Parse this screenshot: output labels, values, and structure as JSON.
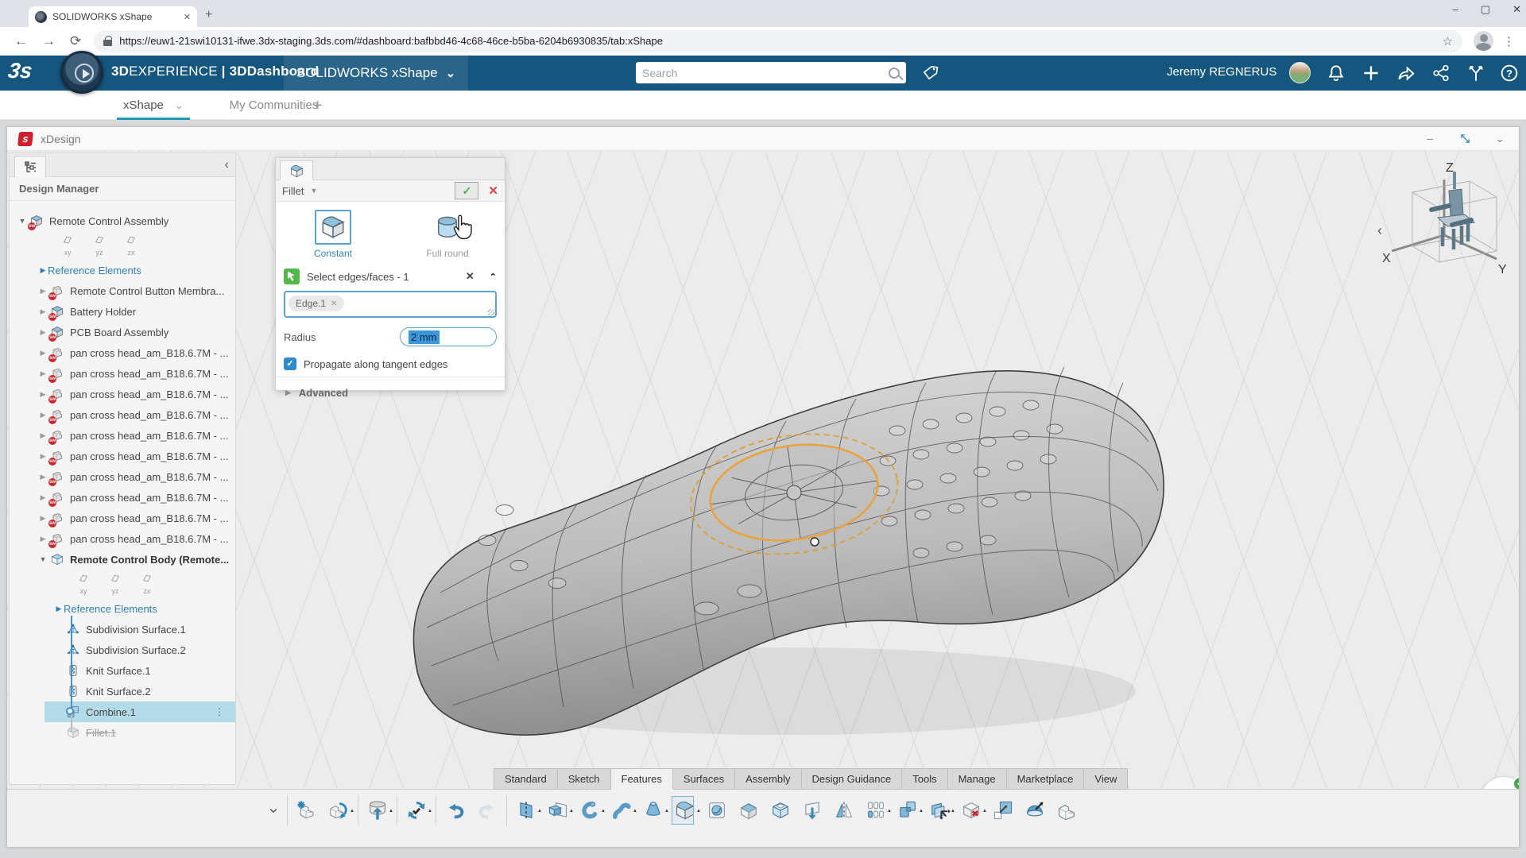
{
  "browser": {
    "tab_title": "SOLIDWORKS xShape",
    "url": "https://euw1-21swi10131-ifwe.3dx-staging.3ds.com/#dashboard:bafbbd46-4c68-46ce-b5ba-6204b6930835/tab:xShape"
  },
  "top_bar": {
    "brand_bold": "3D",
    "brand_light": "EXPERIENCE",
    "divider": "|",
    "dashboard_name": "3DDashboard",
    "app_name": "SOLIDWORKS xShape",
    "search_placeholder": "Search",
    "user_name": "Jeremy REGNERUS",
    "logo_text": "3s"
  },
  "dashboard_tabs": {
    "items": [
      {
        "label": "xShape",
        "active": true,
        "chevron": true
      },
      {
        "label": "My Communities",
        "active": false
      }
    ]
  },
  "app_window": {
    "title": "xDesign",
    "logo_text": "s"
  },
  "design_manager": {
    "title": "Design Manager",
    "tree": [
      {
        "type": "root",
        "level": 0,
        "icon": "asm",
        "badge": true,
        "label": "Remote Control Assembly",
        "expanded": true
      },
      {
        "type": "planes",
        "level": 1,
        "labels": [
          "xy",
          "yz",
          "zx"
        ]
      },
      {
        "type": "ref",
        "level": 1,
        "label": "Reference Elements"
      },
      {
        "type": "item",
        "level": 1,
        "icon": "part",
        "badge": true,
        "arrow": true,
        "label": "Remote Control Button Membra..."
      },
      {
        "type": "item",
        "level": 1,
        "icon": "asm",
        "badge": true,
        "arrow": true,
        "label": "Battery Holder"
      },
      {
        "type": "item",
        "level": 1,
        "icon": "asm",
        "badge": true,
        "arrow": true,
        "label": "PCB Board Assembly"
      },
      {
        "type": "item",
        "level": 1,
        "icon": "part",
        "badge": true,
        "arrow": true,
        "label": "pan cross head_am_B18.6.7M - ..."
      },
      {
        "type": "item",
        "level": 1,
        "icon": "part",
        "badge": true,
        "arrow": true,
        "label": "pan cross head_am_B18.6.7M - ..."
      },
      {
        "type": "item",
        "level": 1,
        "icon": "part",
        "badge": true,
        "arrow": true,
        "label": "pan cross head_am_B18.6.7M - ..."
      },
      {
        "type": "item",
        "level": 1,
        "icon": "part",
        "badge": true,
        "arrow": true,
        "label": "pan cross head_am_B18.6.7M - ..."
      },
      {
        "type": "item",
        "level": 1,
        "icon": "part",
        "badge": true,
        "arrow": true,
        "label": "pan cross head_am_B18.6.7M - ..."
      },
      {
        "type": "item",
        "level": 1,
        "icon": "part",
        "badge": true,
        "arrow": true,
        "label": "pan cross head_am_B18.6.7M - ..."
      },
      {
        "type": "item",
        "level": 1,
        "icon": "part",
        "badge": true,
        "arrow": true,
        "label": "pan cross head_am_B18.6.7M - ..."
      },
      {
        "type": "item",
        "level": 1,
        "icon": "part",
        "badge": true,
        "arrow": true,
        "label": "pan cross head_am_B18.6.7M - ..."
      },
      {
        "type": "item",
        "level": 1,
        "icon": "part",
        "badge": true,
        "arrow": true,
        "label": "pan cross head_am_B18.6.7M - ..."
      },
      {
        "type": "item",
        "level": 1,
        "icon": "part",
        "badge": true,
        "arrow": true,
        "label": "pan cross head_am_B18.6.7M - ..."
      },
      {
        "type": "root",
        "level": 1,
        "icon": "body",
        "bold": true,
        "label": "Remote Control Body (Remote...",
        "expanded": true
      },
      {
        "type": "planes",
        "level": 2,
        "labels": [
          "xy",
          "yz",
          "zx"
        ]
      },
      {
        "type": "ref",
        "level": 2,
        "label": "Reference Elements"
      },
      {
        "type": "item",
        "level": 2,
        "icon": "subdiv",
        "label": "Subdivision Surface.1",
        "tl": true
      },
      {
        "type": "item",
        "level": 2,
        "icon": "subdiv",
        "label": "Subdivision Surface.2",
        "tl": true
      },
      {
        "type": "item",
        "level": 2,
        "icon": "knit",
        "label": "Knit Surface.1",
        "tl": true
      },
      {
        "type": "item",
        "level": 2,
        "icon": "knit",
        "label": "Knit Surface.2",
        "tl": true
      },
      {
        "type": "item",
        "level": 2,
        "icon": "combine",
        "label": "Combine.1",
        "selected": true,
        "tl": "node",
        "menu": true
      },
      {
        "type": "item",
        "level": 2,
        "icon": "filletg",
        "label": "Fillet.1",
        "suppressed": true,
        "tl": "end"
      }
    ]
  },
  "fillet_panel": {
    "title": "Fillet",
    "options": [
      {
        "label": "Constant",
        "selected": true,
        "icon": "fillet"
      },
      {
        "label": "Full round",
        "selected": false,
        "icon": "cyl"
      }
    ],
    "selection_label": "Select edges/faces - 1",
    "chips": [
      "Edge.1"
    ],
    "radius_label": "Radius",
    "radius_value": "2 mm",
    "propagate_label": "Propagate along tangent edges",
    "propagate_checked": true,
    "advanced_label": "Advanced"
  },
  "viewport": {
    "axes": {
      "up": "Z",
      "left": "X",
      "right": "Y"
    }
  },
  "action_bar": {
    "tabs": [
      {
        "label": "Standard"
      },
      {
        "label": "Sketch"
      },
      {
        "label": "Features",
        "active": true
      },
      {
        "label": "Surfaces"
      },
      {
        "label": "Assembly"
      },
      {
        "label": "Design Guidance"
      },
      {
        "label": "Tools"
      },
      {
        "label": "Manage"
      },
      {
        "label": "Marketplace"
      },
      {
        "label": "View"
      }
    ],
    "tools": [
      {
        "name": "collapse-toolbar",
        "sym": "chev",
        "small": true
      },
      {
        "sep": true
      },
      {
        "name": "new-part",
        "sym": "newpart"
      },
      {
        "name": "open",
        "sym": "open",
        "dd": true
      },
      {
        "sep": true
      },
      {
        "name": "save",
        "sym": "db",
        "dd": true
      },
      {
        "sep": true
      },
      {
        "name": "update",
        "sym": "sync",
        "dd": true
      },
      {
        "sep": true
      },
      {
        "name": "undo",
        "sym": "undo"
      },
      {
        "name": "redo",
        "sym": "redo",
        "disabled": true
      },
      {
        "sep": true
      },
      {
        "name": "sketch-plane",
        "sym": "plane",
        "dd": true
      },
      {
        "name": "extrude",
        "sym": "extrude",
        "dd": true
      },
      {
        "name": "revolve",
        "sym": "revolve",
        "dd": true
      },
      {
        "name": "sweep",
        "sym": "sweep",
        "dd": true
      },
      {
        "name": "loft",
        "sym": "loft",
        "dd": true
      },
      {
        "name": "fillet",
        "sym": "fillet",
        "dd": true,
        "active": true
      },
      {
        "name": "hole",
        "sym": "hole"
      },
      {
        "name": "chamfer",
        "sym": "chamfer"
      },
      {
        "name": "shell",
        "sym": "shell"
      },
      {
        "name": "flex",
        "sym": "flex"
      },
      {
        "name": "mirror",
        "sym": "mirror"
      },
      {
        "name": "pattern",
        "sym": "pattern",
        "dd": true
      },
      {
        "name": "combine",
        "sym": "combine",
        "dd": true
      },
      {
        "name": "move",
        "sym": "move",
        "dd": true
      },
      {
        "name": "delete",
        "sym": "delete",
        "dd": true
      },
      {
        "name": "scale",
        "sym": "scale"
      },
      {
        "name": "dome",
        "sym": "dome"
      },
      {
        "name": "body",
        "sym": "body"
      }
    ]
  },
  "glyphs": {
    "minimize": "–",
    "restore": "▢",
    "close": "✕",
    "back": "←",
    "forward": "→",
    "refresh": "⟳",
    "star": "☆",
    "kebab": "⋮",
    "plus": "+",
    "chev_down": "⌄",
    "chev_left": "‹",
    "dots": "⋮",
    "check": "✓",
    "x_small": "✕",
    "caret_up": "▲",
    "tri_right": "▶",
    "tri_down": "▼",
    "restore_app": "⤡",
    "up": "⌃"
  }
}
